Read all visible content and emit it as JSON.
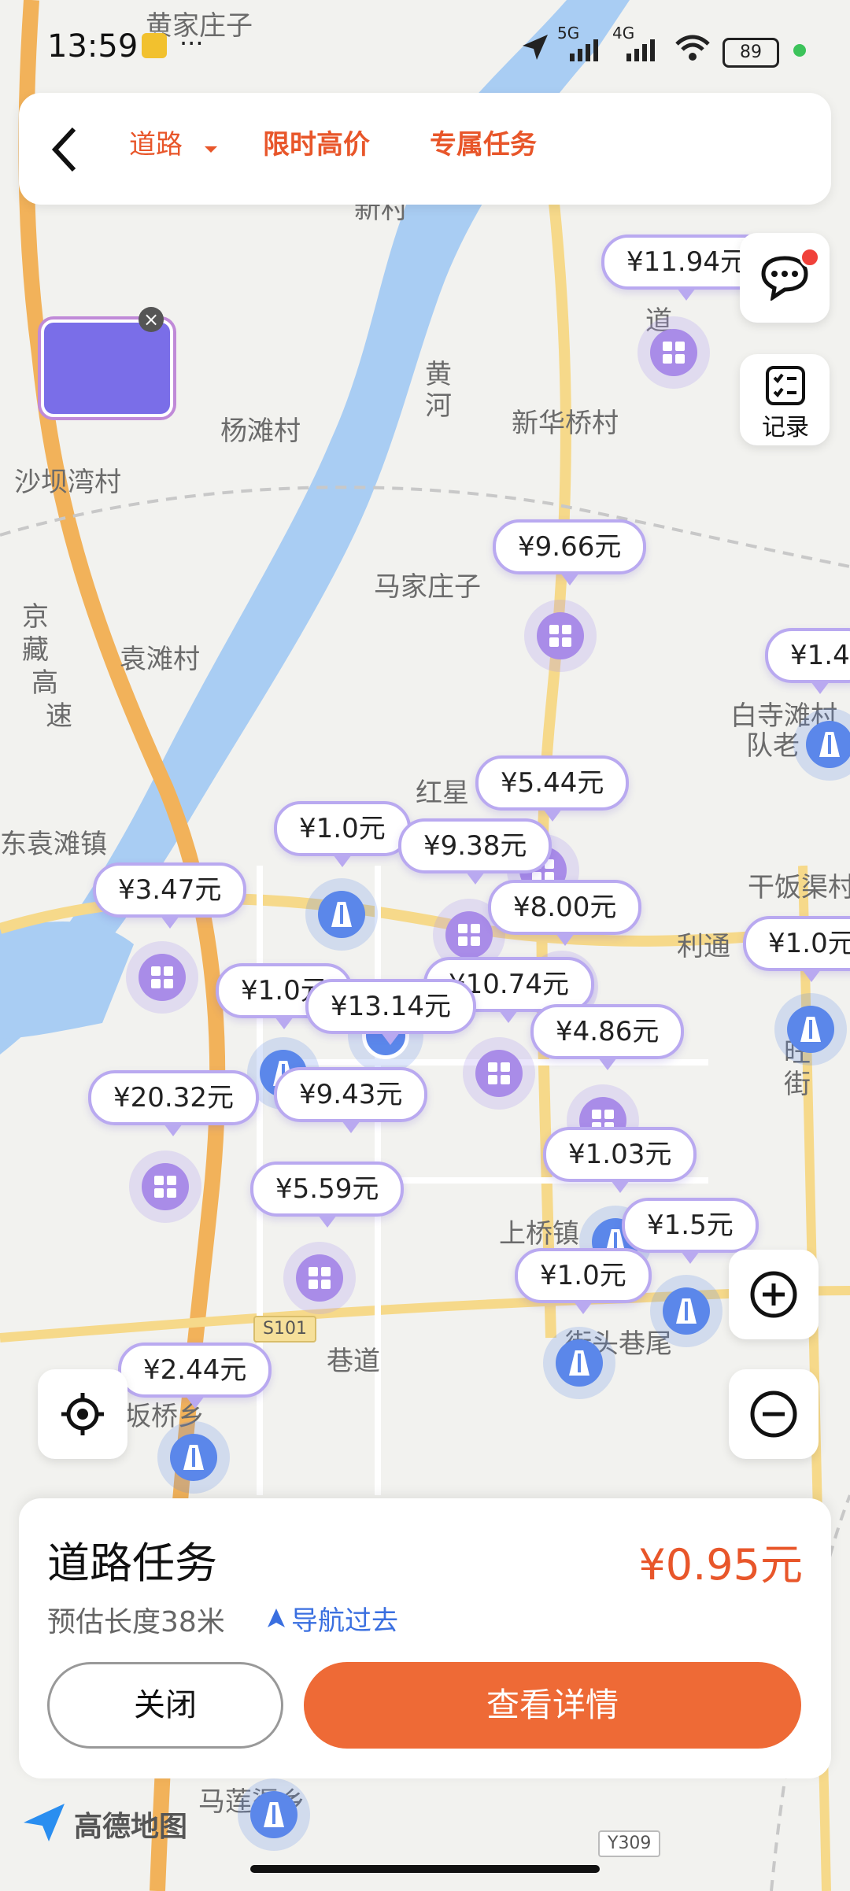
{
  "status_bar": {
    "time": "13:59",
    "dots": "···",
    "net1": "5G",
    "net2": "4G",
    "battery": "89"
  },
  "topbar": {
    "tabs": [
      {
        "label": "道路",
        "selected": true
      },
      {
        "label": "限时高价",
        "selected": false
      },
      {
        "label": "专属任务",
        "selected": false
      }
    ]
  },
  "side": {
    "record_label": "记录"
  },
  "map_labels": [
    "黄家庄子",
    "杨滩村",
    "沙坝湾村",
    "新华桥村",
    "马家庄子",
    "袁滩村",
    "红星",
    "东袁滩镇",
    "利通",
    "干饭渠村",
    "白寺滩村",
    "队老",
    "上桥镇",
    "街头巷尾",
    "巷道",
    "坂桥乡",
    "马莲渠乡",
    "新村",
    "黄",
    "河",
    "京",
    "藏",
    "高",
    "速",
    "旺",
    "街",
    "道"
  ],
  "road_badges": [
    "S101",
    "Y309"
  ],
  "prices": [
    "¥11.94元",
    "¥9.66元",
    "¥1.4",
    "¥5.44元",
    "¥1.0元",
    "¥9.38元",
    "¥3.47元",
    "¥8.00元",
    "¥1.0元",
    "¥1.0元",
    "¥10.74元",
    "¥13.14元",
    "¥4.86元",
    "¥20.32元",
    "¥9.43元",
    "¥1.03元",
    "¥5.59元",
    "¥1.5元",
    "¥1.0元",
    "¥2.44元"
  ],
  "task": {
    "title": "道路任务",
    "price": "¥0.95元",
    "length": "预估长度38米",
    "nav": "导航过去",
    "close_btn": "关闭",
    "details_btn": "查看详情"
  },
  "brand": {
    "name": "高德地图"
  },
  "colors": {
    "accent": "#e8562a",
    "pin_purple": "#a98ce8",
    "pin_blue": "#5b87ea"
  }
}
